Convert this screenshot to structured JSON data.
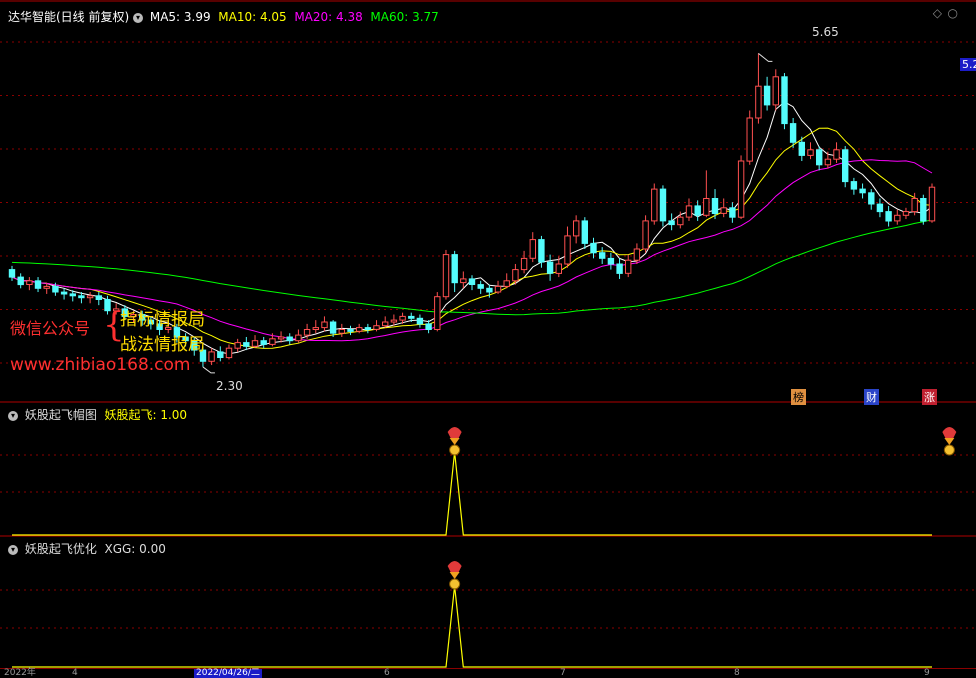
{
  "main_header": {
    "title": "达华智能(日线 前复权)",
    "ma5": "MA5: 3.99",
    "ma10": "MA10: 4.05",
    "ma20": "MA20: 4.38",
    "ma60": "MA60: 3.77"
  },
  "annotations": {
    "high": "5.65",
    "low": "2.30",
    "right_price": "5.2"
  },
  "watermark": {
    "wechat": "微信公众号",
    "line1": "指标情报局",
    "line2": "战法情报局",
    "url": "www.zhibiao168.com"
  },
  "markers": {
    "bang": "榜",
    "cai": "财",
    "zhang": "涨"
  },
  "pane2": {
    "title": "妖股起飞帽图",
    "value": "妖股起飞: 1.00"
  },
  "pane3": {
    "title": "妖股起飞优化",
    "value": "XGG: 0.00"
  },
  "bottom_axis": {
    "left": "2022年",
    "month_a": "4",
    "highlight_date": "2022/04/26/二",
    "month_b": "6",
    "month_c": "7",
    "month_d": "8",
    "month_e": "9"
  },
  "colors": {
    "up": "#ff5050",
    "down": "#54fcfc",
    "ma5": "#ffffff",
    "ma10": "#ffff00",
    "ma20": "#ff00ff",
    "ma60": "#00ff00",
    "grid": "#8b0000"
  },
  "chart_data": [
    {
      "type": "candlestick",
      "title": "达华智能(日线 前复权)",
      "ylim": [
        2.0,
        5.9
      ],
      "series_names": [
        "MA5",
        "MA10",
        "MA20",
        "MA60"
      ],
      "candles": [
        [
          3.34,
          3.26,
          3.38,
          3.22
        ],
        [
          3.26,
          3.18,
          3.3,
          3.14
        ],
        [
          3.18,
          3.22,
          3.26,
          3.12
        ],
        [
          3.22,
          3.14,
          3.26,
          3.1
        ],
        [
          3.14,
          3.16,
          3.2,
          3.08
        ],
        [
          3.16,
          3.1,
          3.2,
          3.06
        ],
        [
          3.1,
          3.08,
          3.14,
          3.02
        ],
        [
          3.08,
          3.06,
          3.12,
          3.0
        ],
        [
          3.06,
          3.04,
          3.1,
          2.98
        ],
        [
          3.04,
          3.06,
          3.1,
          2.98
        ],
        [
          3.06,
          3.02,
          3.1,
          2.96
        ],
        [
          3.02,
          2.9,
          3.06,
          2.86
        ],
        [
          2.9,
          2.92,
          2.98,
          2.86
        ],
        [
          2.92,
          2.84,
          2.96,
          2.8
        ],
        [
          2.84,
          2.86,
          2.9,
          2.78
        ],
        [
          2.86,
          2.8,
          2.9,
          2.74
        ],
        [
          2.8,
          2.76,
          2.84,
          2.7
        ],
        [
          2.76,
          2.7,
          2.8,
          2.64
        ],
        [
          2.7,
          2.72,
          2.78,
          2.66
        ],
        [
          2.72,
          2.62,
          2.76,
          2.56
        ],
        [
          2.62,
          2.58,
          2.66,
          2.52
        ],
        [
          2.58,
          2.48,
          2.62,
          2.42
        ],
        [
          2.48,
          2.36,
          2.52,
          2.3
        ],
        [
          2.36,
          2.46,
          2.5,
          2.32
        ],
        [
          2.46,
          2.4,
          2.52,
          2.36
        ],
        [
          2.4,
          2.5,
          2.54,
          2.38
        ],
        [
          2.5,
          2.56,
          2.6,
          2.46
        ],
        [
          2.56,
          2.52,
          2.62,
          2.48
        ],
        [
          2.52,
          2.58,
          2.64,
          2.5
        ],
        [
          2.58,
          2.54,
          2.62,
          2.5
        ],
        [
          2.54,
          2.6,
          2.66,
          2.52
        ],
        [
          2.6,
          2.62,
          2.68,
          2.56
        ],
        [
          2.62,
          2.58,
          2.66,
          2.54
        ],
        [
          2.58,
          2.64,
          2.7,
          2.56
        ],
        [
          2.64,
          2.7,
          2.76,
          2.6
        ],
        [
          2.7,
          2.72,
          2.8,
          2.66
        ],
        [
          2.72,
          2.78,
          2.84,
          2.68
        ],
        [
          2.78,
          2.66,
          2.8,
          2.62
        ],
        [
          2.66,
          2.7,
          2.76,
          2.62
        ],
        [
          2.7,
          2.68,
          2.74,
          2.64
        ],
        [
          2.68,
          2.72,
          2.76,
          2.66
        ],
        [
          2.72,
          2.7,
          2.76,
          2.66
        ],
        [
          2.7,
          2.74,
          2.8,
          2.68
        ],
        [
          2.74,
          2.78,
          2.84,
          2.72
        ],
        [
          2.78,
          2.8,
          2.86,
          2.74
        ],
        [
          2.8,
          2.84,
          2.88,
          2.76
        ],
        [
          2.84,
          2.82,
          2.88,
          2.78
        ],
        [
          2.82,
          2.76,
          2.86,
          2.72
        ],
        [
          2.76,
          2.7,
          2.8,
          2.66
        ],
        [
          2.7,
          3.05,
          3.1,
          2.68
        ],
        [
          3.05,
          3.5,
          3.55,
          3.02
        ],
        [
          3.5,
          3.2,
          3.54,
          3.1
        ],
        [
          3.2,
          3.24,
          3.32,
          3.14
        ],
        [
          3.24,
          3.18,
          3.28,
          3.12
        ],
        [
          3.18,
          3.14,
          3.22,
          3.08
        ],
        [
          3.14,
          3.1,
          3.18,
          3.04
        ],
        [
          3.1,
          3.16,
          3.22,
          3.08
        ],
        [
          3.16,
          3.22,
          3.3,
          3.14
        ],
        [
          3.22,
          3.34,
          3.4,
          3.18
        ],
        [
          3.34,
          3.46,
          3.54,
          3.3
        ],
        [
          3.46,
          3.66,
          3.74,
          3.42
        ],
        [
          3.66,
          3.42,
          3.7,
          3.36
        ],
        [
          3.42,
          3.3,
          3.5,
          3.22
        ],
        [
          3.3,
          3.4,
          3.48,
          3.26
        ],
        [
          3.4,
          3.7,
          3.8,
          3.36
        ],
        [
          3.7,
          3.86,
          3.92,
          3.62
        ],
        [
          3.86,
          3.62,
          3.9,
          3.56
        ],
        [
          3.62,
          3.52,
          3.68,
          3.46
        ],
        [
          3.52,
          3.46,
          3.58,
          3.4
        ],
        [
          3.46,
          3.4,
          3.52,
          3.34
        ],
        [
          3.4,
          3.3,
          3.46,
          3.24
        ],
        [
          3.3,
          3.44,
          3.5,
          3.26
        ],
        [
          3.44,
          3.56,
          3.62,
          3.4
        ],
        [
          3.56,
          3.86,
          3.92,
          3.52
        ],
        [
          3.86,
          4.2,
          4.26,
          3.82
        ],
        [
          4.2,
          3.86,
          4.24,
          3.8
        ],
        [
          3.86,
          3.82,
          3.94,
          3.76
        ],
        [
          3.82,
          3.9,
          3.96,
          3.78
        ],
        [
          3.9,
          4.02,
          4.1,
          3.86
        ],
        [
          4.02,
          3.92,
          4.08,
          3.86
        ],
        [
          3.92,
          4.1,
          4.4,
          3.9
        ],
        [
          4.1,
          3.94,
          4.2,
          3.88
        ],
        [
          3.94,
          4.0,
          4.1,
          3.9
        ],
        [
          4.0,
          3.9,
          4.06,
          3.84
        ],
        [
          3.9,
          4.5,
          4.56,
          3.88
        ],
        [
          4.5,
          4.96,
          5.04,
          4.46
        ],
        [
          4.96,
          5.3,
          5.65,
          4.9
        ],
        [
          5.3,
          5.1,
          5.4,
          5.04
        ],
        [
          5.1,
          5.4,
          5.48,
          5.04
        ],
        [
          5.4,
          4.9,
          5.44,
          4.84
        ],
        [
          4.9,
          4.7,
          4.96,
          4.64
        ],
        [
          4.7,
          4.56,
          4.76,
          4.5
        ],
        [
          4.56,
          4.62,
          4.7,
          4.52
        ],
        [
          4.62,
          4.46,
          4.66,
          4.4
        ],
        [
          4.46,
          4.52,
          4.6,
          4.42
        ],
        [
          4.52,
          4.62,
          4.7,
          4.48
        ],
        [
          4.62,
          4.28,
          4.66,
          4.22
        ],
        [
          4.28,
          4.2,
          4.32,
          4.14
        ],
        [
          4.2,
          4.16,
          4.26,
          4.1
        ],
        [
          4.16,
          4.04,
          4.2,
          3.98
        ],
        [
          4.04,
          3.96,
          4.1,
          3.9
        ],
        [
          3.96,
          3.86,
          4.02,
          3.8
        ],
        [
          3.86,
          3.92,
          3.98,
          3.82
        ],
        [
          3.92,
          3.96,
          4.0,
          3.88
        ],
        [
          3.96,
          4.1,
          4.16,
          3.92
        ],
        [
          4.1,
          3.86,
          4.14,
          3.82
        ],
        [
          3.86,
          4.22,
          4.26,
          3.84
        ]
      ],
      "ma_legend_values": [
        3.99,
        4.05,
        4.38,
        3.77
      ],
      "high_label": 5.65,
      "low_label": 2.3
    },
    {
      "type": "line",
      "title": "妖股起飞帽图",
      "series": [
        {
          "name": "妖股起飞",
          "values": "zero except signal spikes"
        }
      ],
      "signal_indices": [
        51,
        108
      ],
      "ylim": [
        0,
        1
      ]
    },
    {
      "type": "line",
      "title": "妖股起飞优化",
      "series": [
        {
          "name": "XGG",
          "values": "zero except signal spike"
        }
      ],
      "signal_indices": [
        51
      ],
      "ylim": [
        0,
        1
      ]
    }
  ]
}
